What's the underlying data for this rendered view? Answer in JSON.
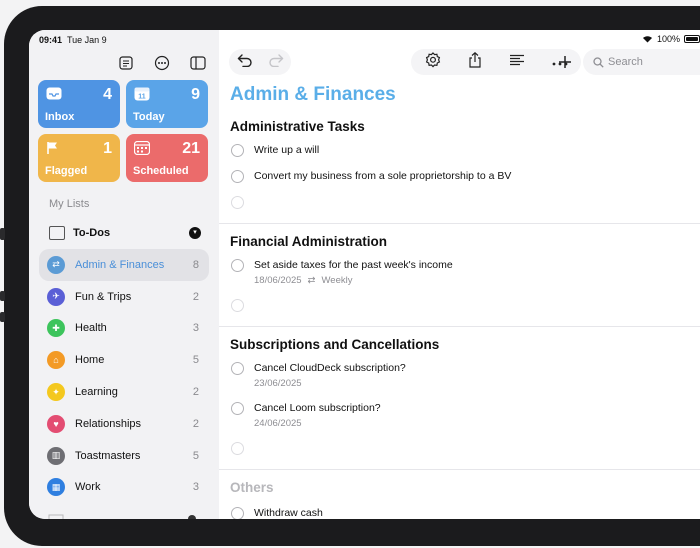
{
  "status_bar": {
    "time": "09:41",
    "date": "Tue Jan 9",
    "battery": "100%"
  },
  "sidebar": {
    "top_icons": [
      "checklist-icon",
      "ellipsis-circle-icon",
      "sidebar-icon"
    ],
    "smart_lists": [
      {
        "id": "inbox",
        "label": "Inbox",
        "count": "4",
        "color": "#4f94e3",
        "icon": "tray-icon"
      },
      {
        "id": "today",
        "label": "Today",
        "count": "9",
        "color": "#5aa4e8",
        "icon": "calendar-11-icon",
        "icon_text": "11"
      },
      {
        "id": "flagged",
        "label": "Flagged",
        "count": "1",
        "color": "#f0b64a",
        "icon": "flag-icon"
      },
      {
        "id": "scheduled",
        "label": "Scheduled",
        "count": "21",
        "color": "#eb6b6b",
        "icon": "calendar-grid-icon"
      }
    ],
    "section_label": "My Lists",
    "group": {
      "label": "To-Dos"
    },
    "lists": [
      {
        "name": "Admin & Finances",
        "count": "8",
        "color": "#5b9bd5",
        "glyph": "⇄",
        "selected": true
      },
      {
        "name": "Fun & Trips",
        "count": "2",
        "color": "#5a5fd6",
        "glyph": "✈"
      },
      {
        "name": "Health",
        "count": "3",
        "color": "#3dc45c",
        "glyph": "✚"
      },
      {
        "name": "Home",
        "count": "5",
        "color": "#f39a25",
        "glyph": "⌂"
      },
      {
        "name": "Learning",
        "count": "2",
        "color": "#f4c81e",
        "glyph": "✦"
      },
      {
        "name": "Relationships",
        "count": "2",
        "color": "#e34d72",
        "glyph": "♥"
      },
      {
        "name": "Toastmasters",
        "count": "5",
        "color": "#6e6e73",
        "glyph": "▥"
      },
      {
        "name": "Work",
        "count": "3",
        "color": "#2f7fe0",
        "glyph": "▦"
      }
    ]
  },
  "toolbar": {
    "undo": "undo-icon",
    "redo": "redo-icon",
    "search_placeholder": "Search"
  },
  "main": {
    "title": "Admin & Finances",
    "sections": [
      {
        "heading": "Administrative Tasks",
        "tasks": [
          {
            "text": "Write up a will"
          },
          {
            "text": "Convert my business from a sole proprietorship to a BV"
          }
        ]
      },
      {
        "heading": "Financial Administration",
        "tasks": [
          {
            "text": "Set aside taxes for the past week's income",
            "date": "18/06/2025",
            "repeat": "Weekly"
          }
        ]
      },
      {
        "heading": "Subscriptions and Cancellations",
        "tasks": [
          {
            "text": "Cancel CloudDeck subscription?",
            "date": "23/06/2025"
          },
          {
            "text": "Cancel Loom subscription?",
            "date": "24/06/2025"
          }
        ]
      },
      {
        "heading": "Others",
        "tasks": [
          {
            "text": "Withdraw cash"
          }
        ]
      }
    ]
  }
}
